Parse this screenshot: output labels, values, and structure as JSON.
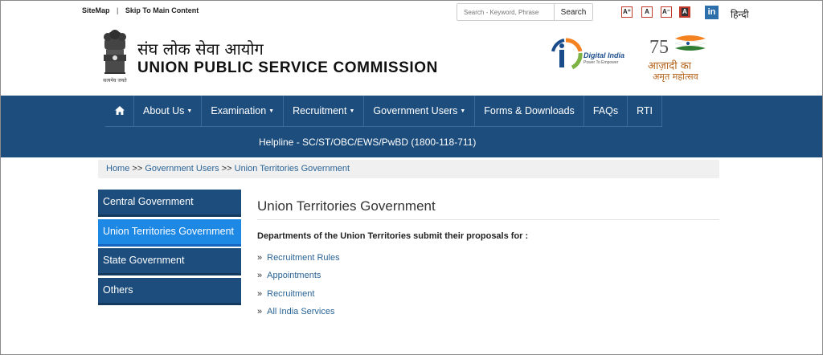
{
  "topbar": {
    "sitemap": "SiteMap",
    "separator": "|",
    "skip": "Skip To Main Content",
    "search_placeholder": "Search - Keyword, Phrase",
    "search_button": "Search",
    "font_increase": "A⁺",
    "font_normal": "A",
    "font_decrease": "A⁻",
    "font_contrast": "A",
    "linkedin": "in",
    "language": "हिन्दी"
  },
  "header": {
    "title_hindi": "संघ लोक सेवा आयोग",
    "title_english": "UNION PUBLIC SERVICE COMMISSION",
    "emblem_motto": "सत्यमेव जयते",
    "digital_india": "Digital India",
    "digital_india_tagline": "Power To Empower",
    "azadi_line1": "आज़ादी का",
    "azadi_line2": "अमृत महोत्सव",
    "azadi_number": "75"
  },
  "nav": {
    "home_icon": "home-icon",
    "items": [
      {
        "label": "About Us",
        "dropdown": true
      },
      {
        "label": "Examination",
        "dropdown": true
      },
      {
        "label": "Recruitment",
        "dropdown": true
      },
      {
        "label": "Government Users",
        "dropdown": true
      },
      {
        "label": "Forms & Downloads",
        "dropdown": false
      },
      {
        "label": "FAQs",
        "dropdown": false
      },
      {
        "label": "RTI",
        "dropdown": false
      }
    ],
    "caret": "▼",
    "helpline": "Helpline - SC/ST/OBC/EWS/PwBD (1800-118-711)"
  },
  "breadcrumb": {
    "home": "Home",
    "sep": ">>",
    "level1": "Government Users",
    "level2": "Union Territories Government"
  },
  "sidebar": {
    "items": [
      {
        "label": "Central Government",
        "active": false
      },
      {
        "label": "Union Territories Government",
        "active": true
      },
      {
        "label": "State Government",
        "active": false
      },
      {
        "label": "Others",
        "active": false
      }
    ]
  },
  "content": {
    "title": "Union Territories Government",
    "intro": "Departments of the Union Territories submit their proposals for :",
    "bullet": "»",
    "links": [
      "Recruitment Rules",
      "Appointments",
      "Recruitment",
      "All India Services"
    ]
  },
  "colors": {
    "nav_bg": "#1d4d7d",
    "active_blue": "#1e88e5",
    "link_blue": "#2a6496",
    "accent_red": "#c0392b"
  }
}
